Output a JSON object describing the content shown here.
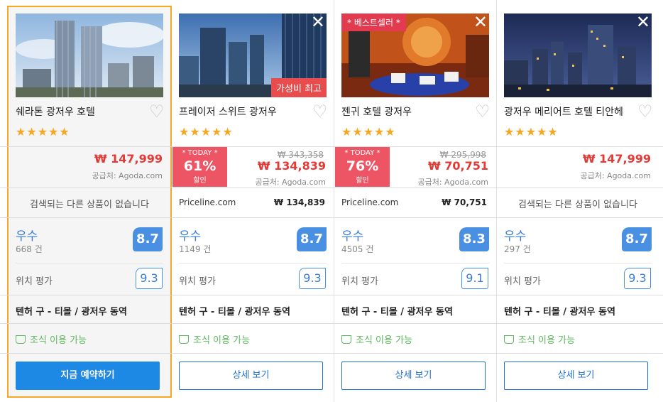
{
  "hotels": [
    {
      "name": "쉐라톤 광저우 호텔",
      "stars": "★★★★★",
      "price": "₩ 147,999",
      "supplier": "공급처: Agoda.com",
      "no_other": "검색되는 다른 상품이 없습니다",
      "rating_word": "우수",
      "reviews": "668 건",
      "score": "8.7",
      "loc_label": "위치 평가",
      "loc_score": "9.3",
      "area": "텐허 구 - 티몰 / 광저우 동역",
      "breakfast": "조식 이용 가능",
      "button": "지금 예약하기"
    },
    {
      "name": "프레이저 스위트 광저우",
      "stars": "★★★★★",
      "badge": "가성비 최고",
      "close": "✕",
      "today_label": "* TODAY *",
      "today_pct": "61%",
      "today_sub": "할인",
      "old_price": "₩ 343,358",
      "price": "₩ 134,839",
      "supplier": "공급처: Agoda.com",
      "vendor": "Priceline.com",
      "vendor_price": "₩ 134,839",
      "rating_word": "우수",
      "reviews": "1149 건",
      "score": "8.7",
      "loc_label": "위치 평가",
      "loc_score": "9.3",
      "area": "텐허 구 - 티몰 / 광저우 동역",
      "breakfast": "조식 이용 가능",
      "button": "상세 보기"
    },
    {
      "name": "젠귀 호텔 광저우",
      "stars": "★★★★★",
      "best": "* 베스트셀러 *",
      "close": "✕",
      "today_label": "* TODAY *",
      "today_pct": "76%",
      "today_sub": "할인",
      "old_price": "₩ 295,998",
      "price": "₩ 70,751",
      "supplier": "공급처: Agoda.com",
      "vendor": "Priceline.com",
      "vendor_price": "₩ 70,751",
      "rating_word": "우수",
      "reviews": "4505 건",
      "score": "8.3",
      "loc_label": "위치 평가",
      "loc_score": "9.1",
      "area": "텐허 구 - 티몰 / 광저우 동역",
      "breakfast": "조식 이용 가능",
      "button": "상세 보기"
    },
    {
      "name": "광저우 메리어트 호텔 티안헤",
      "stars": "★★★★★",
      "close": "✕",
      "price": "₩ 147,999",
      "supplier": "공급처: Agoda.com",
      "no_other": "검색되는 다른 상품이 없습니다",
      "rating_word": "우수",
      "reviews": "297 건",
      "score": "8.7",
      "loc_label": "위치 평가",
      "loc_score": "9.3",
      "area": "텐허 구 - 티몰 / 광저우 동역",
      "breakfast": "조식 이용 가능",
      "button": "상세 보기"
    }
  ],
  "colors": {
    "accent_blue": "#4a90e2",
    "price_red": "#e53935",
    "breakfast_green": "#5cb85c",
    "selected_border": "#f5a623"
  }
}
